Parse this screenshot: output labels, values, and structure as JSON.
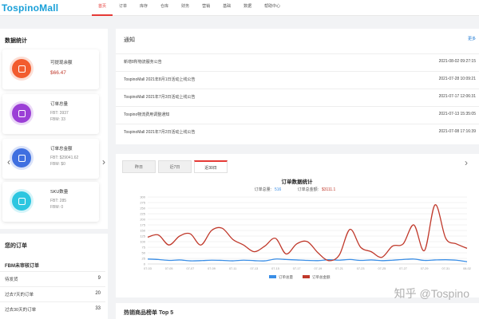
{
  "header": {
    "logo": "TospinoMall",
    "nav": [
      "首页",
      "订单",
      "库存",
      "仓库",
      "财务",
      "营销",
      "基础",
      "数据",
      "帮助中心"
    ]
  },
  "left": {
    "stats_title": "数据统计",
    "cards": [
      {
        "label": "可提现余额",
        "value": "$66.47",
        "color": "#f25c2f",
        "icon": "wallet-icon"
      },
      {
        "label": "订单总量",
        "sub1": "FBT:   3937",
        "sub2": "FBM:  33",
        "color": "#9b3fd6",
        "icon": "cube-icon"
      },
      {
        "label": "订单总金额",
        "sub1": "FBT:   $29041.62",
        "sub2": "FBM:  $0",
        "color": "#3f6fe0",
        "icon": "document-icon"
      },
      {
        "label": "SKU数量",
        "sub1": "FBT:   285",
        "sub2": "FBM:  0",
        "color": "#2cc6e0",
        "icon": "box-icon"
      }
    ],
    "orders_title": "您的订单",
    "orders_sub": "FBM未审核订单",
    "orders": [
      {
        "label": "待发货",
        "value": "9"
      },
      {
        "label": "过去7天的订单",
        "value": "20"
      },
      {
        "label": "过去30天的订单",
        "value": "33"
      }
    ]
  },
  "notice": {
    "title": "通知",
    "more": "更多",
    "items": [
      {
        "title": "新增8所物流服务公告",
        "date": "2021-08-02 09:27:15"
      },
      {
        "title": "TospinoMall 2021年8月1日活动上线公告",
        "date": "2021-07-28 10:09:21"
      },
      {
        "title": "TospinoMall 2021年7月3日活动上线公告",
        "date": "2021-07-17 12:06:31"
      },
      {
        "title": "Tospino物流费用调整通知",
        "date": "2021-07-13 15:35:05"
      },
      {
        "title": "TospinoMall 2021年7月2日活动上线公告",
        "date": "2021-07-08 17:16:39"
      }
    ]
  },
  "chart_panel": {
    "tabs": [
      "昨日",
      "近7日",
      "近30日"
    ],
    "active_tab": 2
  },
  "chart_data": {
    "type": "line",
    "title": "订单数据统计",
    "summary": {
      "count_label": "订单总量:",
      "count_value": "516",
      "amount_label": "订单总金额:",
      "amount_value": "$3111.1"
    },
    "x": [
      "07-03",
      "07-04",
      "07-05",
      "07-06",
      "07-07",
      "07-08",
      "07-09",
      "07-10",
      "07-11",
      "07-12",
      "07-13",
      "07-14",
      "07-15",
      "07-16",
      "07-17",
      "07-18",
      "07-19",
      "07-20",
      "07-21",
      "07-22",
      "07-23",
      "07-24",
      "07-25",
      "07-26",
      "07-27",
      "07-28",
      "07-29",
      "07-30",
      "07-31",
      "08-01",
      "08-02"
    ],
    "ylim": [
      0,
      300
    ],
    "yticks": [
      0,
      25,
      50,
      75,
      100,
      125,
      150,
      175,
      200,
      225,
      250,
      275,
      300
    ],
    "series": [
      {
        "name": "订单总量",
        "color": "#3a8ee6",
        "values": [
          22,
          20,
          16,
          18,
          14,
          15,
          17,
          16,
          14,
          17,
          15,
          14,
          22,
          20,
          18,
          16,
          15,
          19,
          17,
          20,
          16,
          18,
          15,
          17,
          20,
          22,
          16,
          18,
          19,
          17,
          10
        ]
      },
      {
        "name": "订单总金额",
        "color": "#c0392b",
        "values": [
          120,
          130,
          85,
          125,
          135,
          85,
          150,
          160,
          110,
          85,
          55,
          80,
          115,
          45,
          90,
          100,
          50,
          15,
          40,
          155,
          75,
          55,
          30,
          80,
          90,
          175,
          60,
          265,
          115,
          90,
          70
        ]
      }
    ]
  },
  "hot": {
    "title": "热销商品榜单 Top 5"
  },
  "watermark": "知乎 @Tospino"
}
